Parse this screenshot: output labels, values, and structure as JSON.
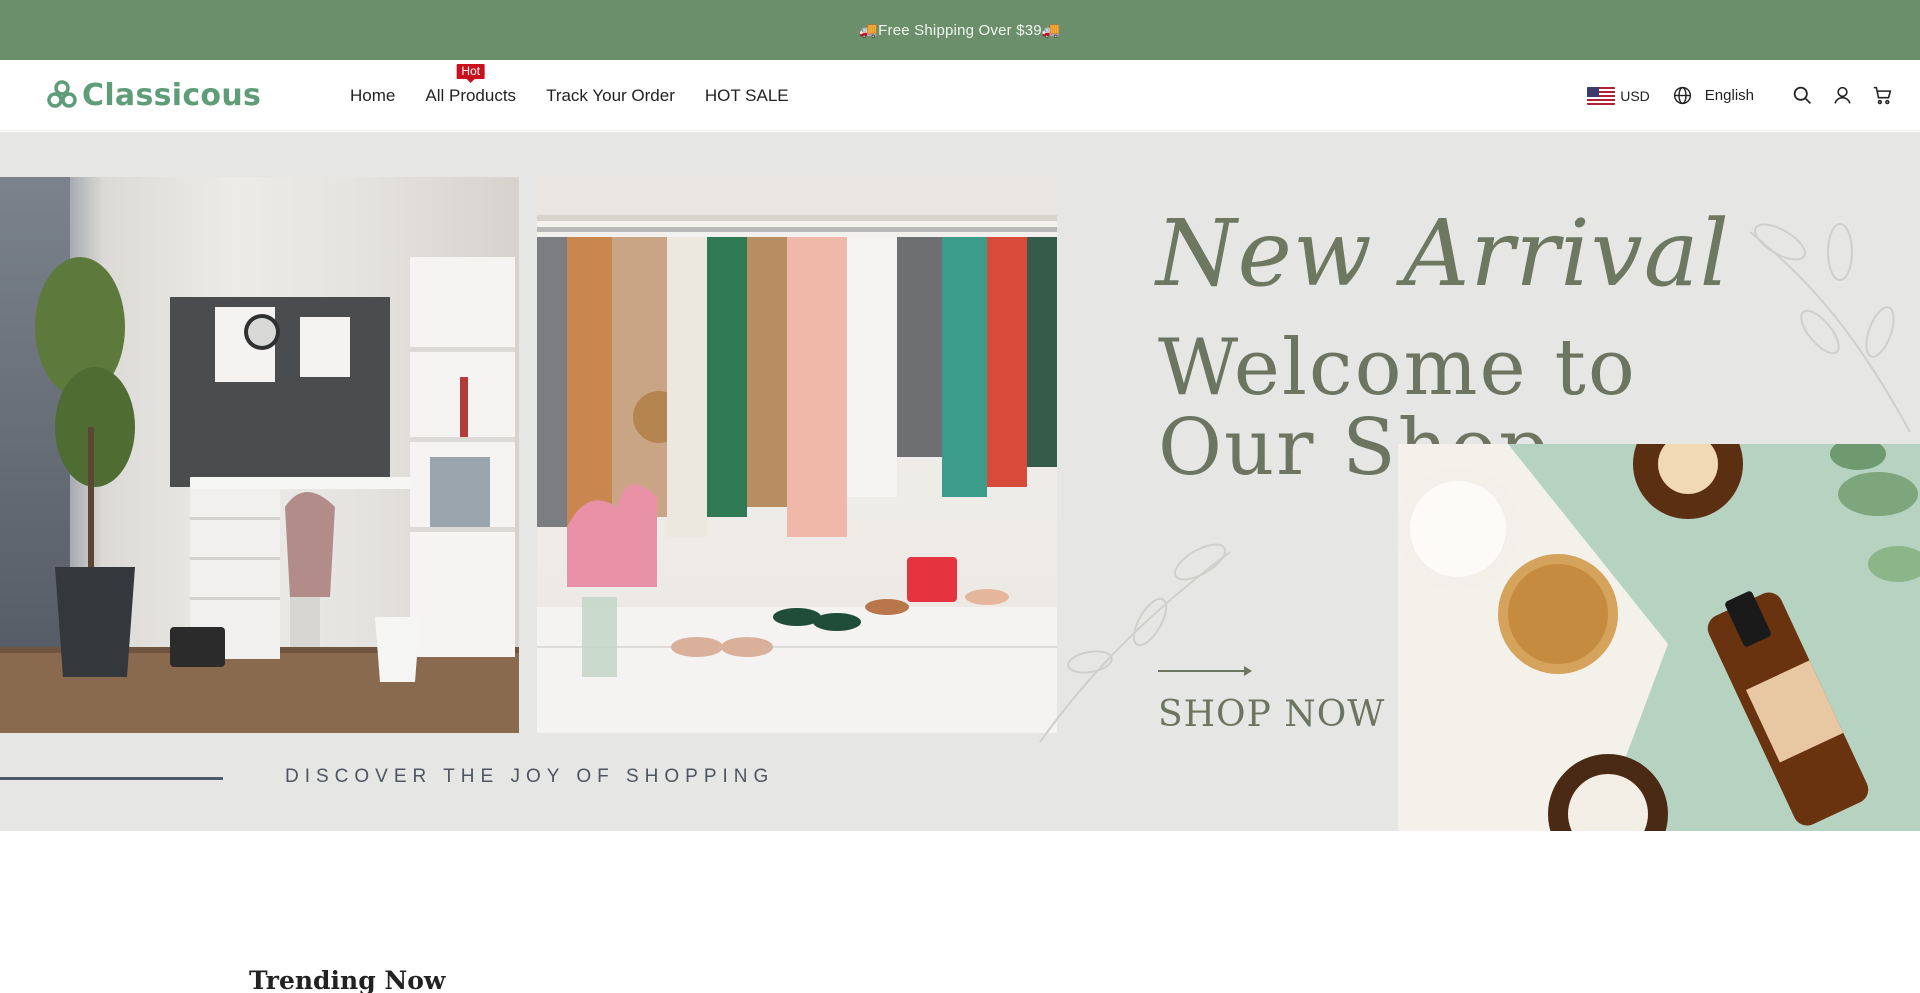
{
  "announcement": {
    "text": "🚚Free Shipping Over $39🚚"
  },
  "header": {
    "logo_text": "Classicous",
    "nav": [
      {
        "label": "Home"
      },
      {
        "label": "All Products",
        "badge": "Hot"
      },
      {
        "label": "Track Your Order"
      },
      {
        "label": "HOT SALE"
      }
    ],
    "currency": "USD",
    "language": "English",
    "icons": [
      "flag-us-icon",
      "globe-icon",
      "search-icon",
      "account-icon",
      "cart-icon"
    ]
  },
  "hero": {
    "script_text": "New Arrival",
    "title": "Welcome to Our Shop",
    "cta": "SHOP NOW",
    "tagline": "DISCOVER THE JOY OF SHOPPING"
  },
  "section": {
    "title": "Trending Now"
  },
  "colors": {
    "announcement_bg": "#6b8f6b",
    "brand": "#5f9d78",
    "hot_badge": "#c8101e",
    "hero_text": "#6d7561",
    "hero_bg": "#e6e6e4"
  }
}
